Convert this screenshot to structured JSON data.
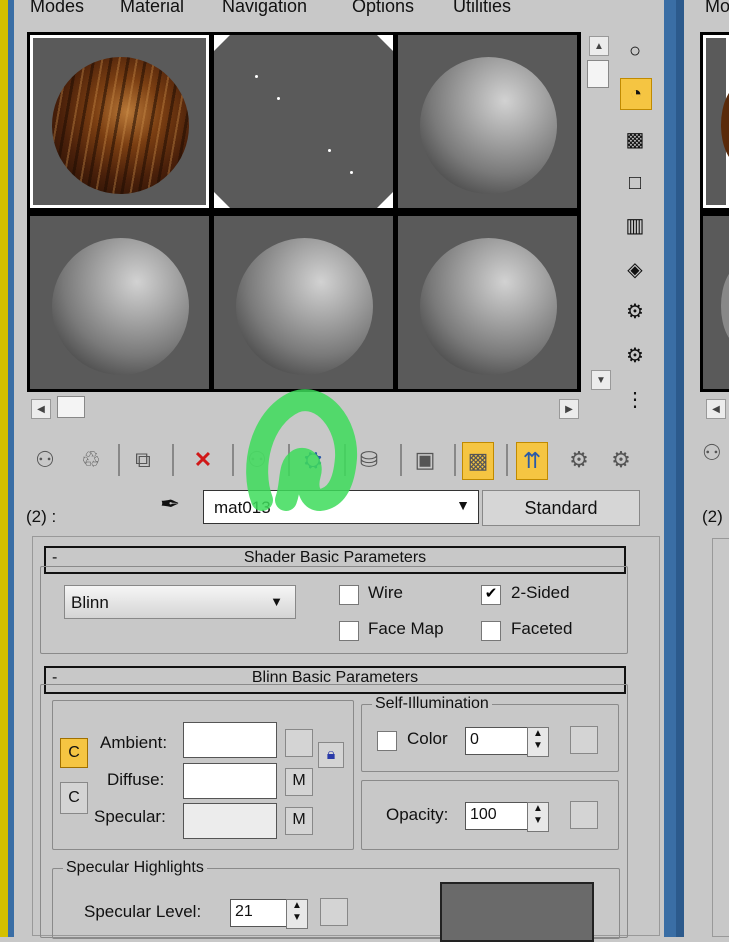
{
  "menu": [
    "Modes",
    "Material",
    "Navigation",
    "Options",
    "Utilities"
  ],
  "right_panel": {
    "menu_partial": "Mo",
    "slot_label_partial": "(2)"
  },
  "slot_label": "(2) :",
  "material": {
    "name": "mat013",
    "type_button": "Standard"
  },
  "shader_rollout": {
    "title": "Shader Basic Parameters",
    "shader": "Blinn",
    "wire": "Wire",
    "two_sided": "2-Sided",
    "face_map": "Face Map",
    "faceted": "Faceted"
  },
  "blinn_rollout": {
    "title": "Blinn Basic Parameters",
    "ambient": "Ambient:",
    "diffuse": "Diffuse:",
    "specular": "Specular:",
    "m1": "M",
    "m2": "M",
    "self_illum_title": "Self-Illumination",
    "color_label": "Color",
    "color_value": "0",
    "opacity_label": "Opacity:",
    "opacity_value": "100"
  },
  "spec_highlights": {
    "title": "Specular Highlights",
    "level_label": "Specular Level:",
    "level_value": "21"
  },
  "icons": [
    "sample-type-sphere-icon",
    "backlight-icon",
    "background-checker-icon",
    "uv-tiling-icon",
    "video-color-check-icon",
    "make-preview-icon",
    "options-icon",
    "select-by-material-icon",
    "material-map-navigator-icon",
    "get-material-icon",
    "put-to-scene-icon",
    "assign-to-selection-icon",
    "reset-map-icon",
    "make-unique-icon",
    "put-to-library-icon",
    "material-id-channel-icon",
    "show-in-viewport-icon",
    "show-end-result-icon",
    "go-to-parent-icon",
    "go-forward-sibling-icon",
    "eyedropper-icon",
    "lock-icon"
  ],
  "colors": {
    "active_button": "#f5c542",
    "highlight_annotation": "#3ddc5a",
    "panel_bg": "#c8c8c8"
  }
}
